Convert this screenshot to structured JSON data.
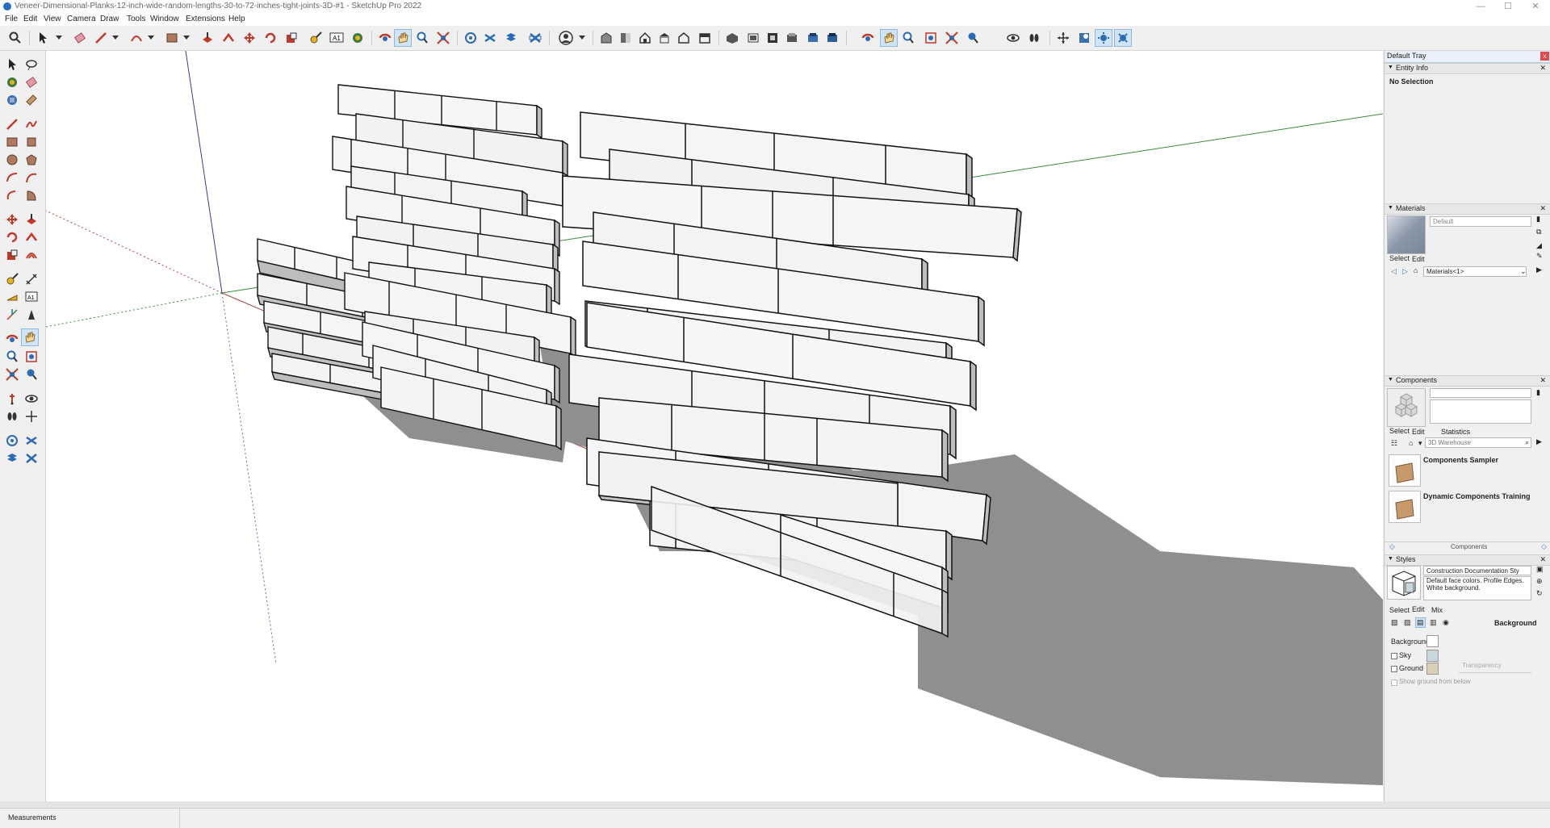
{
  "window": {
    "title": "Veneer-Dimensional-Planks-12-inch-wide-random-lengths-30-to-72-inches-tight-joints-3D-#1 - SketchUp Pro 2022",
    "minimize": "—",
    "maximize": "☐",
    "close": "✕"
  },
  "menu": [
    "File",
    "Edit",
    "View",
    "Camera",
    "Draw",
    "Tools",
    "Window",
    "Extensions",
    "Help"
  ],
  "tray": {
    "title": "Default Tray",
    "close": "x",
    "entity_info": {
      "title": "Entity Info",
      "selection": "No Selection"
    },
    "materials": {
      "title": "Materials",
      "name_field": "Default",
      "tab_select": "Select",
      "tab_edit": "Edit",
      "collection": "Materials<1>"
    },
    "components": {
      "title": "Components",
      "tab_select": "Select",
      "tab_edit": "Edit",
      "tab_statistics": "Statistics",
      "search_placeholder": "3D Warehouse",
      "items": [
        {
          "name": "Components Sampler"
        },
        {
          "name": "Dynamic Components Training"
        }
      ],
      "footer": "Components"
    },
    "styles": {
      "title": "Styles",
      "style_name": "Construction Documentation Sty",
      "style_desc": "Default face colors. Profile Edges. White background.",
      "tab_select": "Select",
      "tab_edit": "Edit",
      "tab_mix": "Mix",
      "section": "Background",
      "background_label": "Background",
      "sky_label": "Sky",
      "ground_label": "Ground",
      "transparency_label": "Transparency",
      "show_ground_below": "Show ground from below",
      "colors": {
        "background": "#ffffff",
        "sky": "#c8d7dc",
        "ground": "#d9cfb4"
      }
    }
  },
  "status": {
    "measurements_label": "Measurements"
  },
  "colors": {
    "accent": "#cfe4f7",
    "shadow": "#8c8c8c",
    "plank_face": "#f4f4f4"
  }
}
